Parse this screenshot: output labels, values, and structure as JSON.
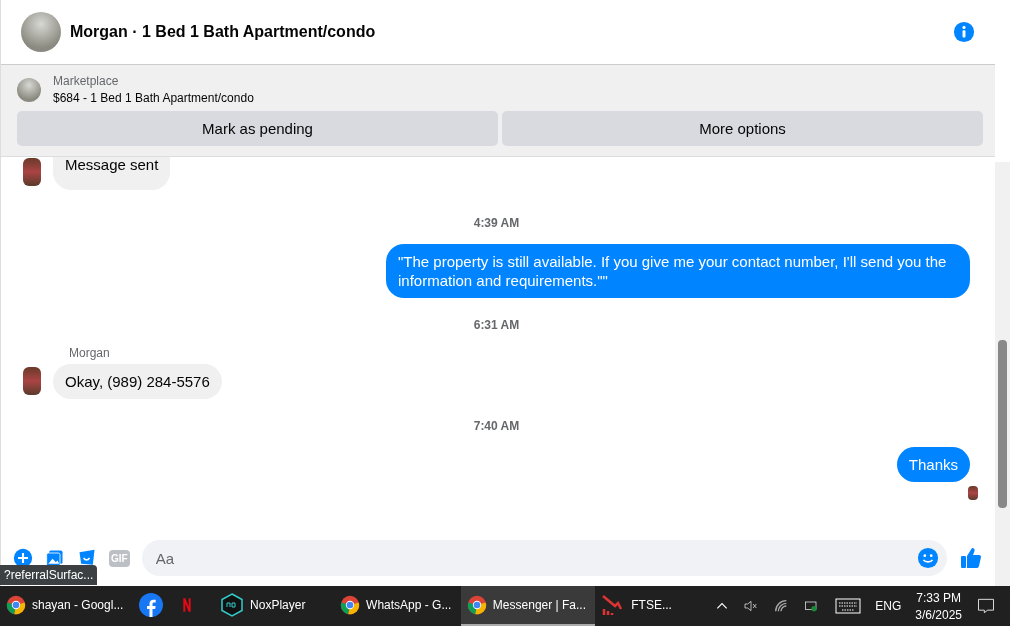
{
  "header": {
    "title": "Morgan · 1 Bed 1 Bath Apartment/condo"
  },
  "listing": {
    "source": "Marketplace",
    "summary": "$684 - 1 Bed 1 Bath Apartment/condo",
    "buttons": [
      "Mark as pending",
      "More options"
    ]
  },
  "messages": [
    {
      "kind": "incoming",
      "text": "Message sent"
    },
    {
      "kind": "time",
      "text": "4:39 AM"
    },
    {
      "kind": "outgoing",
      "text": "\"The property is still available. If you give me your contact number, I'll send you the information and requirements.\"\""
    },
    {
      "kind": "time",
      "text": "6:31 AM"
    },
    {
      "kind": "incoming",
      "sender": "Morgan",
      "text": "Okay, (989) 284-5576"
    },
    {
      "kind": "time",
      "text": "7:40 AM"
    },
    {
      "kind": "outgoing",
      "text": "Thanks",
      "seen": true
    }
  ],
  "composer": {
    "placeholder": "Aa",
    "gif_label": "GIF"
  },
  "tooltip": "?referralSurfac...",
  "taskbar": {
    "items": [
      {
        "kind": "chrome",
        "label": "shayan - Googl...",
        "selected": false
      },
      {
        "kind": "facebook",
        "selected": false
      },
      {
        "kind": "netflix",
        "selected": false
      },
      {
        "kind": "nox",
        "label": "NoxPlayer",
        "selected": false
      },
      {
        "kind": "chrome",
        "label": "WhatsApp - G...",
        "selected": false
      },
      {
        "kind": "chrome",
        "label": "Messenger | Fa...",
        "selected": true
      },
      {
        "kind": "chart",
        "label": "FTSE...",
        "selected": false
      }
    ],
    "language": "ENG",
    "time": "7:33 PM",
    "date": "3/6/2025"
  }
}
